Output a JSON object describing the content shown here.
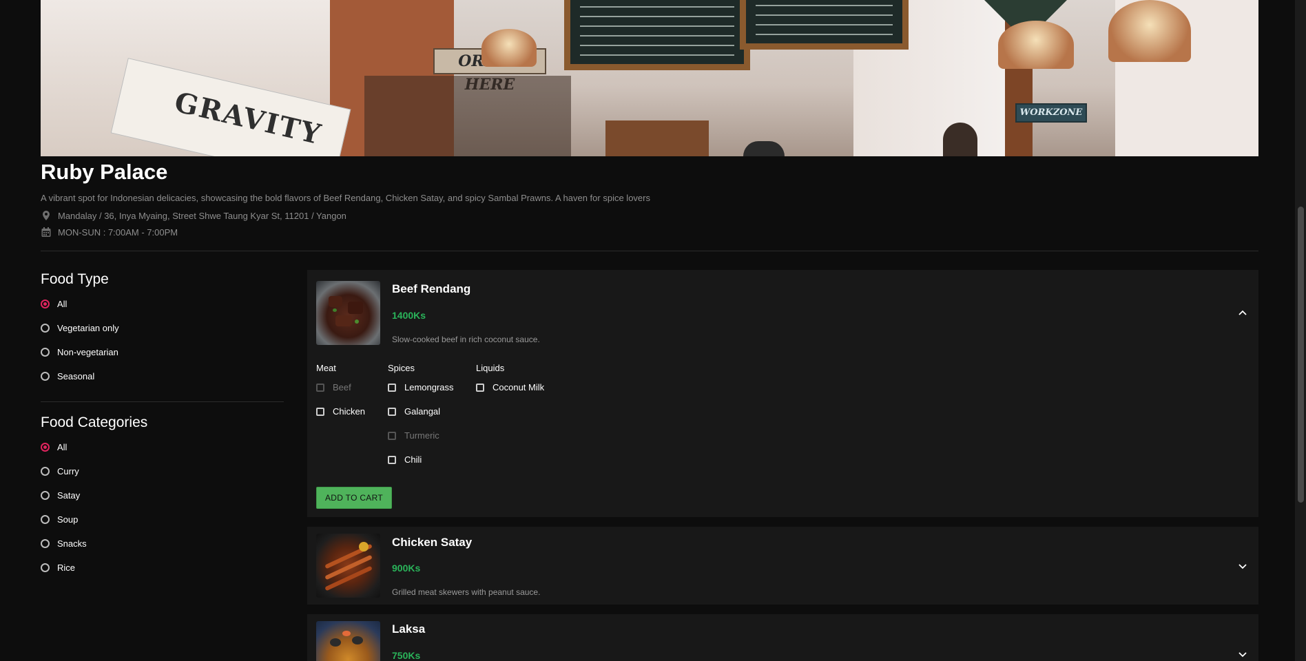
{
  "restaurant": {
    "name": "Ruby Palace",
    "description": "A vibrant spot for Indonesian delicacies, showcasing the bold flavors of Beef Rendang, Chicken Satay, and spicy Sambal Prawns. A haven for spice lovers",
    "address": "Mandalay / 36, Inya Myaing, Street Shwe Taung Kyar St, 11201 / Yangon",
    "hours": "MON-SUN : 7:00AM - 7:00PM",
    "hero_texts": {
      "sign": "ORDER HERE",
      "paper": "GRAVITY",
      "workzone": "WORKZONE"
    }
  },
  "filters": {
    "food_type": {
      "title": "Food Type",
      "options": [
        {
          "label": "All",
          "selected": true
        },
        {
          "label": "Vegetarian only",
          "selected": false
        },
        {
          "label": "Non-vegetarian",
          "selected": false
        },
        {
          "label": "Seasonal",
          "selected": false
        }
      ]
    },
    "food_categories": {
      "title": "Food Categories",
      "options": [
        {
          "label": "All",
          "selected": true
        },
        {
          "label": "Curry",
          "selected": false
        },
        {
          "label": "Satay",
          "selected": false
        },
        {
          "label": "Soup",
          "selected": false
        },
        {
          "label": "Snacks",
          "selected": false
        },
        {
          "label": "Rice",
          "selected": false
        }
      ]
    }
  },
  "menu": {
    "items": [
      {
        "name": "Beef Rendang",
        "price": "1400Ks",
        "description": "Slow-cooked beef in rich coconut sauce.",
        "expanded": true,
        "ingredients": {
          "meat": {
            "title": "Meat",
            "items": [
              {
                "label": "Beef",
                "disabled": true
              },
              {
                "label": "Chicken",
                "disabled": false
              }
            ]
          },
          "spices": {
            "title": "Spices",
            "items": [
              {
                "label": "Lemongrass",
                "disabled": false
              },
              {
                "label": "Galangal",
                "disabled": false
              },
              {
                "label": "Turmeric",
                "disabled": true
              },
              {
                "label": "Chili",
                "disabled": false
              }
            ]
          },
          "liquids": {
            "title": "Liquids",
            "items": [
              {
                "label": "Coconut Milk",
                "disabled": false
              }
            ]
          }
        },
        "add_to_cart_label": "ADD TO CART"
      },
      {
        "name": "Chicken Satay",
        "price": "900Ks",
        "description": "Grilled meat skewers with peanut sauce.",
        "expanded": false
      },
      {
        "name": "Laksa",
        "price": "750Ks",
        "description": "",
        "expanded": false
      }
    ]
  },
  "colors": {
    "accent_radio": "#e0245e",
    "price_green": "#2ab45a",
    "button_green": "#4fb35b",
    "background": "#0d0d0d",
    "card": "#181818"
  },
  "icons": {
    "address": "location-pin-icon",
    "hours": "calendar-icon",
    "collapse": "chevron-up-icon",
    "expand": "chevron-down-icon"
  }
}
